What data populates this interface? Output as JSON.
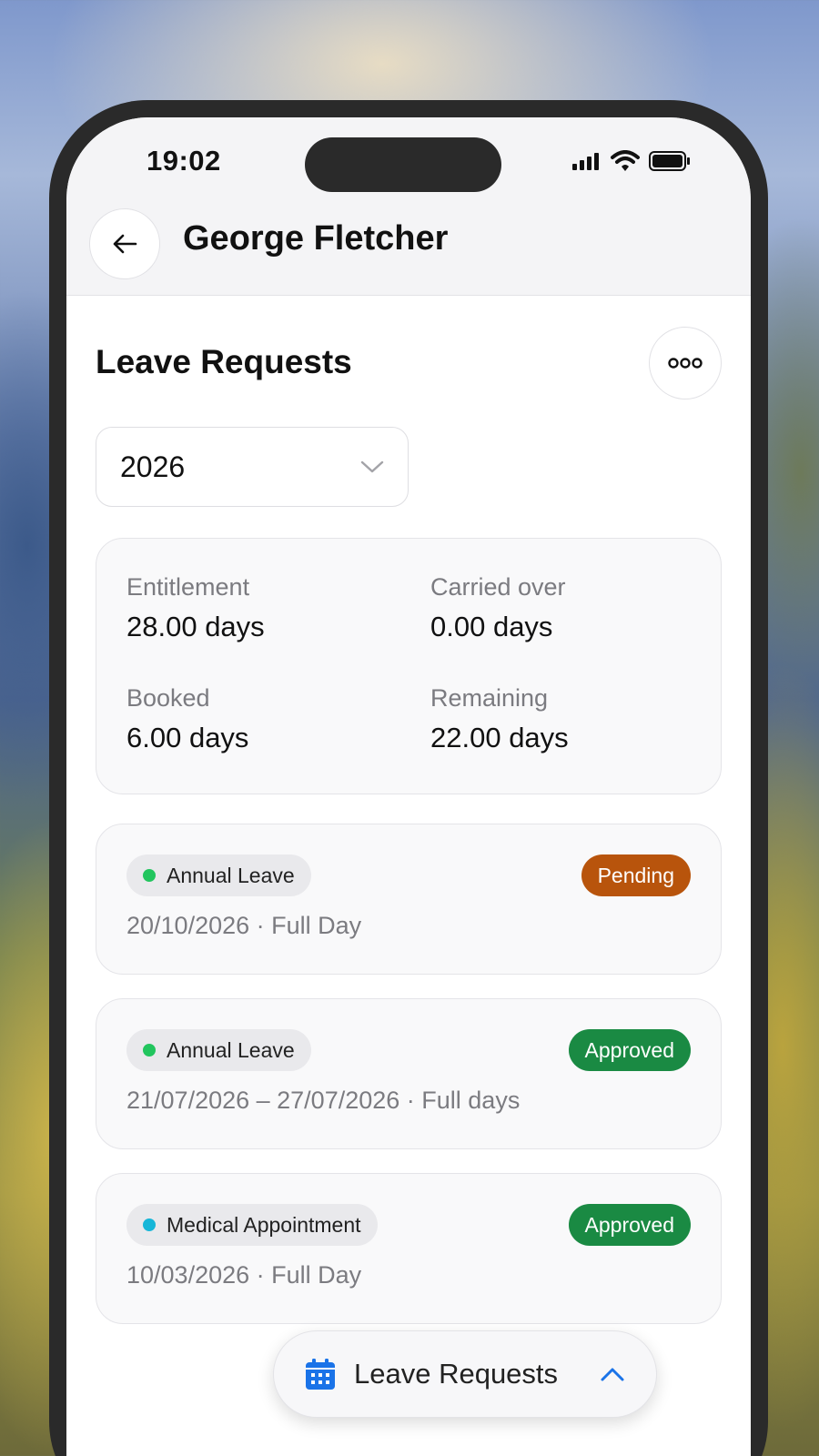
{
  "status_bar": {
    "time": "19:02"
  },
  "header": {
    "title": "George Fletcher"
  },
  "section": {
    "title": "Leave Requests"
  },
  "year_select": {
    "value": "2026"
  },
  "summary": {
    "entitlement_label": "Entitlement",
    "entitlement_value": "28.00 days",
    "carried_label": "Carried over",
    "carried_value": "0.00 days",
    "booked_label": "Booked",
    "booked_value": "6.00 days",
    "remaining_label": "Remaining",
    "remaining_value": "22.00 days"
  },
  "requests": [
    {
      "type": "Annual Leave",
      "type_color": "#22c55e",
      "status": "Pending",
      "status_color": "#b8540c",
      "detail": "20/10/2026 · Full Day"
    },
    {
      "type": "Annual Leave",
      "type_color": "#22c55e",
      "status": "Approved",
      "status_color": "#1a8a43",
      "detail": "21/07/2026 – 27/07/2026 · Full days"
    },
    {
      "type": "Medical Appointment",
      "type_color": "#16b6d8",
      "status": "Approved",
      "status_color": "#1a8a43",
      "detail": "10/03/2026 · Full Day"
    }
  ],
  "fab": {
    "label": "Leave Requests",
    "icon": "calendar-icon",
    "icon_color": "#1a73e8"
  }
}
